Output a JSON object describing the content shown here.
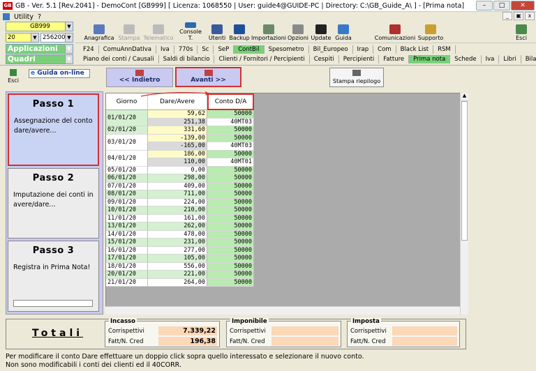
{
  "titlebar": {
    "text": "GB - Ver. 5.1 [Rev.2041] - DemoCont [GB999]    [ Licenza: 1068550 | User: guide4@GUIDE-PC | Directory: C:\\GB_Guide_A\\ ] - [Prima nota]",
    "logo": "GB"
  },
  "menu": {
    "items": [
      "Utility",
      "?"
    ]
  },
  "selectors": {
    "company": "GB999",
    "year": "20",
    "code": "256200 -",
    "applicazioni": "Applicazioni",
    "quadri": "Quadri"
  },
  "toolbar": [
    {
      "label": "Anagrafica",
      "icon": "book-icon",
      "enabled": true
    },
    {
      "label": "Stampa",
      "icon": "printer-icon",
      "enabled": false
    },
    {
      "label": "Telematico",
      "icon": "satellite-icon",
      "enabled": false
    },
    {
      "label": "Console T.",
      "icon": "console-icon",
      "enabled": true
    },
    {
      "label": "Utenti",
      "icon": "users-icon",
      "enabled": true
    },
    {
      "label": "Backup",
      "icon": "backup-icon",
      "enabled": true
    },
    {
      "label": "Importazioni",
      "icon": "import-icon",
      "enabled": true
    },
    {
      "label": "Opzioni",
      "icon": "wrench-icon",
      "enabled": true
    },
    {
      "label": "Update",
      "icon": "monitor-icon",
      "enabled": true
    },
    {
      "label": "Guida",
      "icon": "help-icon",
      "enabled": true
    },
    {
      "label": "Comunicazioni",
      "icon": "communications-icon",
      "enabled": true
    },
    {
      "label": "Supporto",
      "icon": "support-icon",
      "enabled": true
    },
    {
      "label": "Esci",
      "icon": "exit-icon",
      "enabled": true
    }
  ],
  "tabs_row1": [
    "F24",
    "ComuAnnDatIva",
    "Iva",
    "770s",
    "Sc",
    "SeP",
    "ContBil",
    "Spesometro",
    "Bil_Europeo",
    "Irap",
    "Com",
    "Black List",
    "RSM"
  ],
  "tabs_row1_active": "ContBil",
  "tabs_row2": [
    "Piano dei conti / Causali",
    "Saldi di bilancio",
    "Clienti / Fornitori / Percipienti",
    "Cespiti",
    "Percipienti",
    "Fatture",
    "Prima nota",
    "Schede",
    "Iva",
    "Libri",
    "Bilancio"
  ],
  "tabs_row2_active": "Prima nota",
  "actions": {
    "esci": "Esci",
    "guida_online": "Guida on-line",
    "indietro": "<< Indietro",
    "avanti": "Avanti >>",
    "stampa_riepilogo": "Stampa riepilogo"
  },
  "steps": [
    {
      "title": "Passo 1",
      "desc": "Assegnazione del conto dare/avere...",
      "active": true
    },
    {
      "title": "Passo 2",
      "desc": "Imputazione dei conti in avere/dare...",
      "active": false
    },
    {
      "title": "Passo 3",
      "desc": "Registra in Prima Nota!",
      "active": false
    }
  ],
  "grid": {
    "headers": [
      "Giorno",
      "Dare/Avere",
      "Conto D/A"
    ],
    "rows": [
      {
        "giorno": "01/01/20",
        "importo": "59,62",
        "conto": "50000",
        "span": 2
      },
      {
        "giorno": "",
        "importo": "251,38",
        "conto": "40MT03"
      },
      {
        "giorno": "02/01/20",
        "importo": "331,60",
        "conto": "50000"
      },
      {
        "giorno": "03/01/20",
        "importo": "-139,00",
        "conto": "50000",
        "span": 2
      },
      {
        "giorno": "",
        "importo": "-165,00",
        "conto": "40MT03"
      },
      {
        "giorno": "04/01/20",
        "importo": "186,00",
        "conto": "50000",
        "span": 2
      },
      {
        "giorno": "",
        "importo": "110,00",
        "conto": "40MT01"
      },
      {
        "giorno": "05/01/20",
        "importo": "0,00",
        "conto": "50000"
      },
      {
        "giorno": "06/01/20",
        "importo": "298,00",
        "conto": "50000"
      },
      {
        "giorno": "07/01/20",
        "importo": "409,00",
        "conto": "50000"
      },
      {
        "giorno": "08/01/20",
        "importo": "711,00",
        "conto": "50000"
      },
      {
        "giorno": "09/01/20",
        "importo": "224,00",
        "conto": "50000"
      },
      {
        "giorno": "10/01/20",
        "importo": "210,00",
        "conto": "50000"
      },
      {
        "giorno": "11/01/20",
        "importo": "161,00",
        "conto": "50000"
      },
      {
        "giorno": "13/01/20",
        "importo": "262,00",
        "conto": "50000"
      },
      {
        "giorno": "14/01/20",
        "importo": "478,00",
        "conto": "50000"
      },
      {
        "giorno": "15/01/20",
        "importo": "231,00",
        "conto": "50000"
      },
      {
        "giorno": "16/01/20",
        "importo": "277,00",
        "conto": "50000"
      },
      {
        "giorno": "17/01/20",
        "importo": "105,00",
        "conto": "50000"
      },
      {
        "giorno": "18/01/20",
        "importo": "556,00",
        "conto": "50000"
      },
      {
        "giorno": "20/01/20",
        "importo": "221,00",
        "conto": "50000"
      },
      {
        "giorno": "21/01/20",
        "importo": "264,00",
        "conto": "50000"
      }
    ]
  },
  "totali": {
    "label": "Totali",
    "incasso": {
      "title": "Incasso",
      "corrispettivi_label": "Corrispettivi",
      "corrispettivi": "7.339,22",
      "fatt_label": "Fatt/N. Cred",
      "fatt": "196,38"
    },
    "imponibile": {
      "title": "Imponibile",
      "corrispettivi_label": "Corrispettivi",
      "corrispettivi": "",
      "fatt_label": "Fatt/N. Cred",
      "fatt": ""
    },
    "imposta": {
      "title": "Imposta",
      "corrispettivi_label": "Corrispettivi",
      "corrispettivi": "",
      "fatt_label": "Fatt/N. Cred",
      "fatt": ""
    }
  },
  "footer": {
    "line1": "Per modificare il conto Dare effettuare un doppio click sopra quello interessato e selezionare il nuovo conto.",
    "line2": "Non sono modificabili i conti dei clienti ed il 40CORR."
  }
}
